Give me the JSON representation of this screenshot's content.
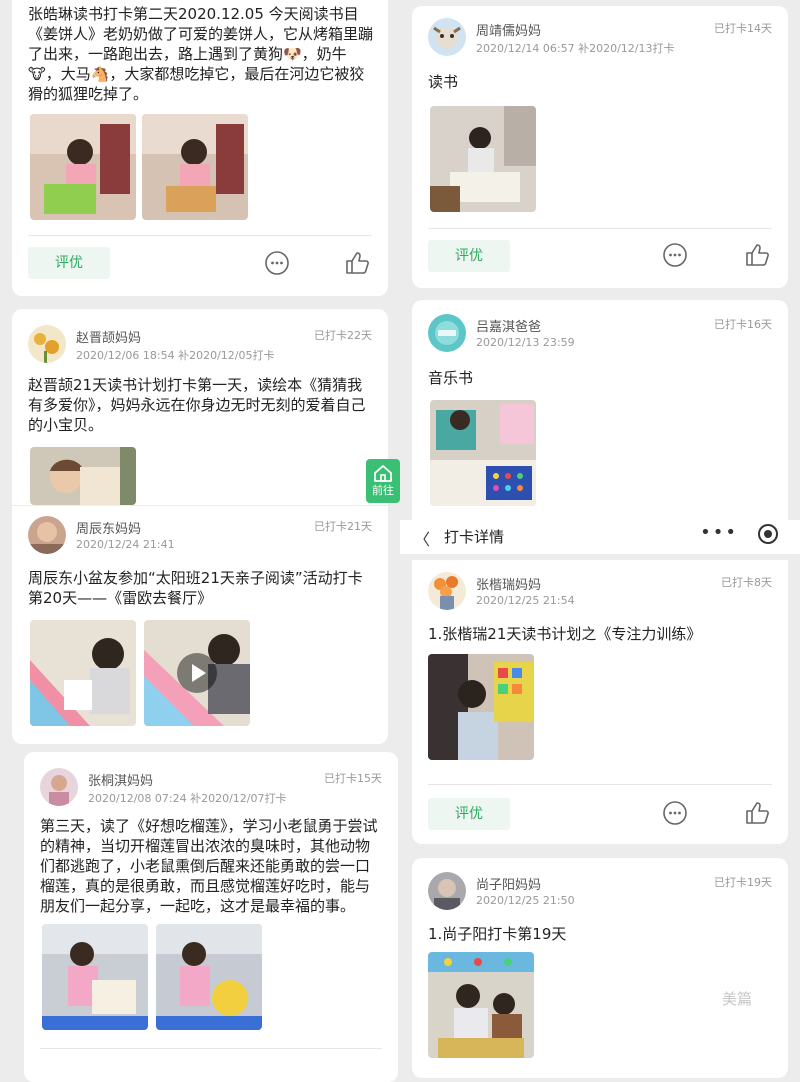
{
  "posts": {
    "zhang_haolin": {
      "content": "张皓琳读书打卡第二天2020.12.05 今天阅读书目《姜饼人》老奶奶做了可爱的姜饼人，它从烤箱里蹦了出来，一路跑出去，路上遇到了黄狗🐶，奶牛🐮，大马🐴，大家都想吃掉它，最后在河边它被狡猾的狐狸吃掉了。",
      "rate_label": "评优"
    },
    "zhao_jinxi": {
      "name": "赵晋颉妈妈",
      "time": "2020/12/06 18:54 补2020/12/05打卡",
      "days": "已打卡22天",
      "content": "赵晋颉21天读书计划打卡第一天，读绘本《猜猜我有多爱你》，妈妈永远在你身边无时无刻的爱着自己的小宝贝。"
    },
    "zhou_chendong": {
      "name": "周辰东妈妈",
      "time": "2020/12/24 21:41",
      "days": "已打卡21天",
      "content": "周辰东小盆友参加“太阳班21天亲子阅读”活动打卡第20天——《雷欧去餐厅》"
    },
    "zhang_tongqi": {
      "name": "张桐淇妈妈",
      "time": "2020/12/08 07:24 补2020/12/07打卡",
      "days": "已打卡15天",
      "content": "第三天，读了《好想吃榴莲》，学习小老鼠勇于尝试的精神，当切开榴莲冒出浓浓的臭味时，其他动物们都逃跑了，小老鼠熏倒后醒来还能勇敢的尝一口榴莲，真的是很勇敢，而且感觉榴莲好吃时，能与朋友们一起分享，一起吃，这才是最幸福的事。"
    },
    "zhou_jingru": {
      "name": "周靖儒妈妈",
      "time": "2020/12/14 06:57 补2020/12/13打卡",
      "days": "已打卡14天",
      "content": "读书",
      "rate_label": "评优"
    },
    "lv_jiaqi": {
      "name": "吕嘉淇爸爸",
      "time": "2020/12/13 23:59",
      "days": "已打卡16天",
      "content": "音乐书"
    },
    "zhang_kairui": {
      "name": "张楷瑞妈妈",
      "time": "2020/12/25 21:54",
      "days": "已打卡8天",
      "content": "1.张楷瑞21天读书计划之《专注力训练》",
      "rate_label": "评优"
    },
    "shang_ziyang": {
      "name": "尚子阳妈妈",
      "time": "2020/12/25 21:50",
      "days": "已打卡19天",
      "content": "1.尚子阳打卡第19天"
    }
  },
  "float_button": {
    "label": "前往"
  },
  "top_bar": {
    "back": "〈",
    "title": "打卡详情",
    "more": "•••"
  },
  "watermark": "美篇",
  "colors": {
    "accent": "#3bbf74",
    "rate_bg": "#eef6f1",
    "rate_text": "#2faa5e"
  }
}
